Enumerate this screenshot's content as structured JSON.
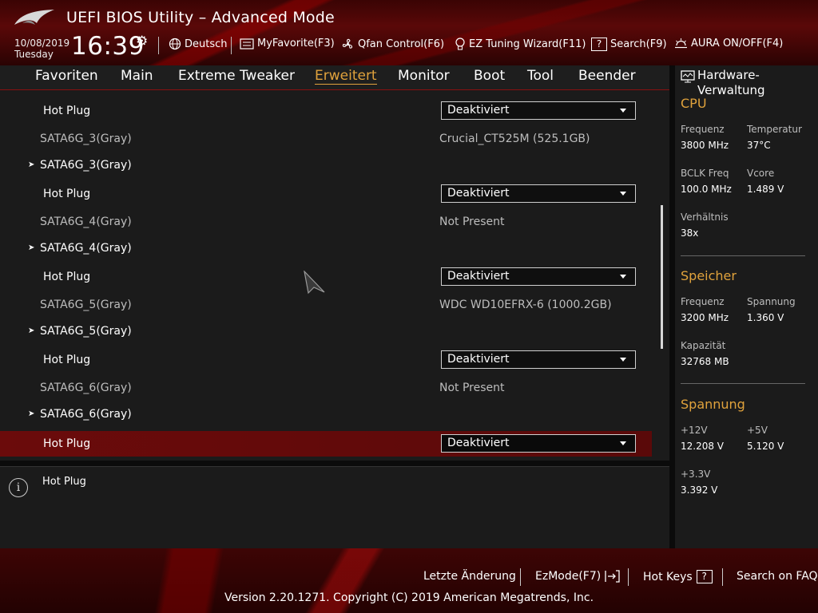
{
  "header": {
    "title": "UEFI BIOS Utility – Advanced Mode",
    "date": "10/08/2019",
    "weekday": "Tuesday",
    "time": "16:39",
    "tools": [
      {
        "label": "Deutsch",
        "icon": "globe-icon"
      },
      {
        "label": "MyFavorite(F3)",
        "icon": "favorite-list-icon"
      },
      {
        "label": "Qfan Control(F6)",
        "icon": "fan-icon"
      },
      {
        "label": "EZ Tuning Wizard(F11)",
        "icon": "lightbulb-icon"
      },
      {
        "label": "Search(F9)",
        "icon": "question-box-icon"
      },
      {
        "label": "AURA ON/OFF(F4)",
        "icon": "aura-icon"
      }
    ]
  },
  "nav": {
    "tabs": [
      "Favoriten",
      "Main",
      "Extreme Tweaker",
      "Erweitert",
      "Monitor",
      "Boot",
      "Tool",
      "Beender"
    ],
    "active": "Erweitert"
  },
  "main": {
    "rows": [
      {
        "type": "hotplug",
        "label": "Hot Plug",
        "value": "Deaktiviert"
      },
      {
        "type": "info",
        "label": "SATA6G_3(Gray)",
        "value": "Crucial_CT525M (525.1GB)"
      },
      {
        "type": "sub",
        "label": "SATA6G_3(Gray)"
      },
      {
        "type": "hotplug",
        "label": "Hot Plug",
        "value": "Deaktiviert"
      },
      {
        "type": "info",
        "label": "SATA6G_4(Gray)",
        "value": "Not Present"
      },
      {
        "type": "sub",
        "label": "SATA6G_4(Gray)"
      },
      {
        "type": "hotplug",
        "label": "Hot Plug",
        "value": "Deaktiviert"
      },
      {
        "type": "info",
        "label": "SATA6G_5(Gray)",
        "value": "WDC WD10EFRX-6 (1000.2GB)"
      },
      {
        "type": "sub",
        "label": "SATA6G_5(Gray)"
      },
      {
        "type": "hotplug",
        "label": "Hot Plug",
        "value": "Deaktiviert"
      },
      {
        "type": "info",
        "label": "SATA6G_6(Gray)",
        "value": "Not Present"
      },
      {
        "type": "sub",
        "label": "SATA6G_6(Gray)"
      },
      {
        "type": "hotplug",
        "label": "Hot Plug",
        "value": "Deaktiviert",
        "selected": true
      }
    ]
  },
  "help": {
    "text": "Hot Plug"
  },
  "hw": {
    "title": "Hardware-Verwaltung",
    "cpu": {
      "heading": "CPU",
      "freq_label": "Frequenz",
      "freq_value": "3800 MHz",
      "temp_label": "Temperatur",
      "temp_value": "37°C",
      "bclk_label": "BCLK Freq",
      "bclk_value": "100.0 MHz",
      "vcore_label": "Vcore",
      "vcore_value": "1.489 V",
      "ratio_label": "Verhältnis",
      "ratio_value": "38x"
    },
    "memory": {
      "heading": "Speicher",
      "freq_label": "Frequenz",
      "freq_value": "3200 MHz",
      "volt_label": "Spannung",
      "volt_value": "1.360 V",
      "cap_label": "Kapazität",
      "cap_value": "32768 MB"
    },
    "voltage": {
      "heading": "Spannung",
      "v12_label": "+12V",
      "v12_value": "12.208 V",
      "v5_label": "+5V",
      "v5_value": "5.120 V",
      "v33_label": "+3.3V",
      "v33_value": "3.392 V"
    }
  },
  "footer": {
    "last_change": "Letzte Änderung",
    "ezmode": "EzMode(F7)",
    "hotkeys": "Hot Keys",
    "hotkeys_key": "?",
    "faq": "Search on FAQ",
    "copyright": "Version 2.20.1271. Copyright (C) 2019 American Megatrends, Inc."
  },
  "colors": {
    "accent": "#e0a23c",
    "selected_row": "#6b0b0b",
    "header_red": "#5a0808"
  }
}
